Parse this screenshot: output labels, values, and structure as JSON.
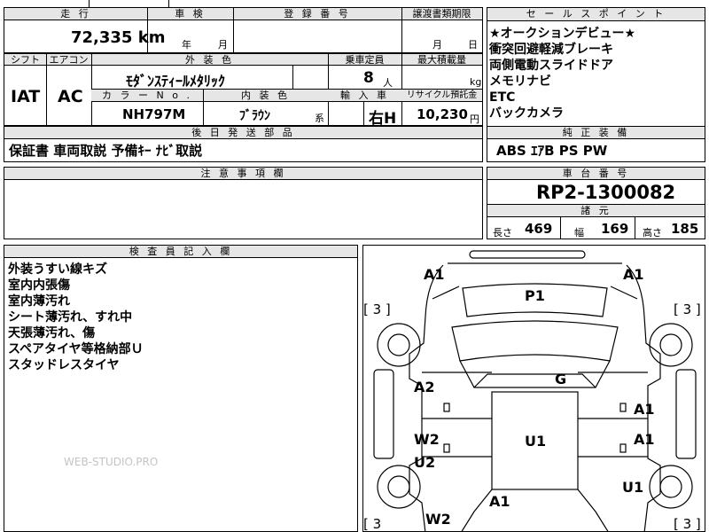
{
  "header": {
    "mileage_label": "走 行",
    "inspection_label": "車 検",
    "registration_label": "登 録 番 号",
    "transfer_label": "譲渡書類期限",
    "sales_points_label": "セ ー ル ス ポ イ ン ト"
  },
  "row1": {
    "mileage": "72,335",
    "mileage_unit": "km",
    "inspection_year_unit": "年",
    "inspection_month_unit": "月",
    "transfer_month_unit": "月",
    "transfer_day_unit": "日"
  },
  "sales_points": [
    "★オークションデビュー★",
    "衝突回避軽減ブレーキ",
    "両側電動スライドドア",
    "メモリナビ",
    "ETC",
    "バックカメラ"
  ],
  "row2_labels": {
    "shift": "シフト",
    "aircon": "エアコン",
    "exterior_color": "外 装 色",
    "capacity": "乗車定員",
    "max_load": "最大積載量",
    "color_no": "カ ラ ー N o .",
    "interior_color": "内 装 色",
    "import": "輸 入 車",
    "recycle": "リサイクル預託金"
  },
  "row2": {
    "shift": "IAT",
    "aircon": "AC",
    "exterior_color": "ﾓﾀﾞﾝｽﾃｨｰﾙﾒﾀﾘｯｸ",
    "capacity": "8",
    "capacity_unit": "人",
    "max_load_unit": "kg",
    "color_no": "NH797M",
    "interior_color": "ﾌﾞﾗｳﾝ",
    "interior_suffix": "系",
    "import": "右H",
    "recycle": "10,230",
    "recycle_unit": "円"
  },
  "accessories": {
    "label": "後 日 発 送 部 品",
    "value": "保証書 車両取説 予備ｷｰ ﾅﾋﾞ取説"
  },
  "equipment": {
    "label": "純 正 装 備",
    "value": "ABS ｴｱB PS PW"
  },
  "notes": {
    "label": "注 意 事 項 欄"
  },
  "chassis": {
    "label": "車 台 番 号",
    "value": "RP2-1300082",
    "dims_label": "諸 元",
    "length_label": "長さ",
    "length": "469",
    "width_label": "幅",
    "width": "169",
    "height_label": "高さ",
    "height": "185"
  },
  "inspector": {
    "label": "検 査 員 記 入 欄",
    "items": [
      "外装うすい線キズ",
      "室内内張傷",
      "室内薄汚れ",
      "シート薄汚れ、すれ中",
      "天張薄汚れ、傷",
      "スペアタイヤ等格納部Ｕ",
      "スタッドレスタイヤ"
    ],
    "watermark": "WEB-STUDIO.PRO"
  },
  "diagram": {
    "marks": {
      "a1_front_left": "A1",
      "a1_front_right": "A1",
      "p1": "P1",
      "tire_fl": "[ 3 ]",
      "tire_fr": "[ 3 ]",
      "g": "G",
      "a2": "A2",
      "a1_right_mid": "A1",
      "w2_left": "W2",
      "u2_left": "U2",
      "u1_center": "U1",
      "a1_right_lower": "A1",
      "u1_right": "U1",
      "w2_rear": "W2",
      "a1_rear": "A1",
      "tire_rl": "[ 3",
      "tire_rr": "[ 3 ]"
    }
  }
}
